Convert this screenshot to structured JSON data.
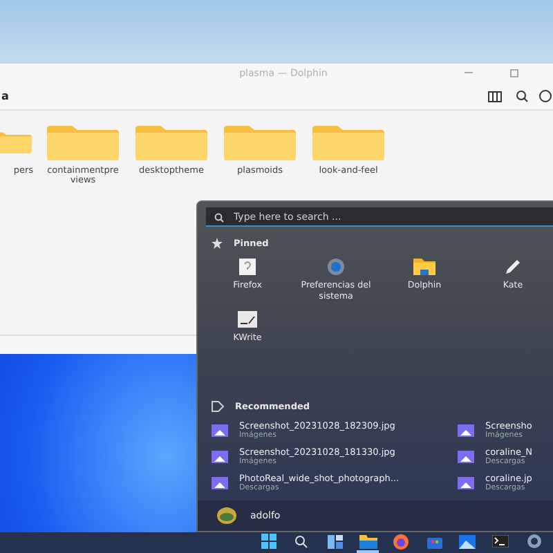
{
  "window": {
    "title": "plasma — Dolphin",
    "breadcrumb": "a"
  },
  "folders": [
    {
      "name": "pers"
    },
    {
      "name": "containmentpre views"
    },
    {
      "name": "desktoptheme"
    },
    {
      "name": "plasmoids"
    },
    {
      "name": "look-and-feel"
    }
  ],
  "start_menu": {
    "search": {
      "placeholder": "Type here to search ..."
    },
    "pinned_title": "Pinned",
    "pinned": [
      {
        "label": "Firefox",
        "kind": "unknown"
      },
      {
        "label": "Preferencias del sistema",
        "kind": "settings"
      },
      {
        "label": "Dolphin",
        "kind": "folder"
      },
      {
        "label": "Kate",
        "kind": "pen"
      },
      {
        "label": "KWrite",
        "kind": "editor"
      }
    ],
    "recommended_title": "Recommended",
    "recommended": [
      {
        "name": "Screenshot_20231028_182309.jpg",
        "location": "Imágenes"
      },
      {
        "name": "Screensho",
        "location": "Imágenes"
      },
      {
        "name": "Screenshot_20231028_181330.jpg",
        "location": "Imágenes"
      },
      {
        "name": "coraline_N",
        "location": "Descargas"
      },
      {
        "name": "PhotoReal_wide_shot_photograph...",
        "location": "Descargas"
      },
      {
        "name": "coraline.jp",
        "location": "Descargas"
      }
    ],
    "user": "adolfo"
  },
  "taskbar": [
    {
      "kind": "start",
      "selected": false
    },
    {
      "kind": "search",
      "selected": false
    },
    {
      "kind": "widgets",
      "selected": false
    },
    {
      "kind": "files",
      "selected": true
    },
    {
      "kind": "browser",
      "selected": false
    },
    {
      "kind": "store",
      "selected": false
    },
    {
      "kind": "photos",
      "selected": false
    },
    {
      "kind": "terminal",
      "selected": false
    },
    {
      "kind": "settings",
      "selected": false
    }
  ]
}
